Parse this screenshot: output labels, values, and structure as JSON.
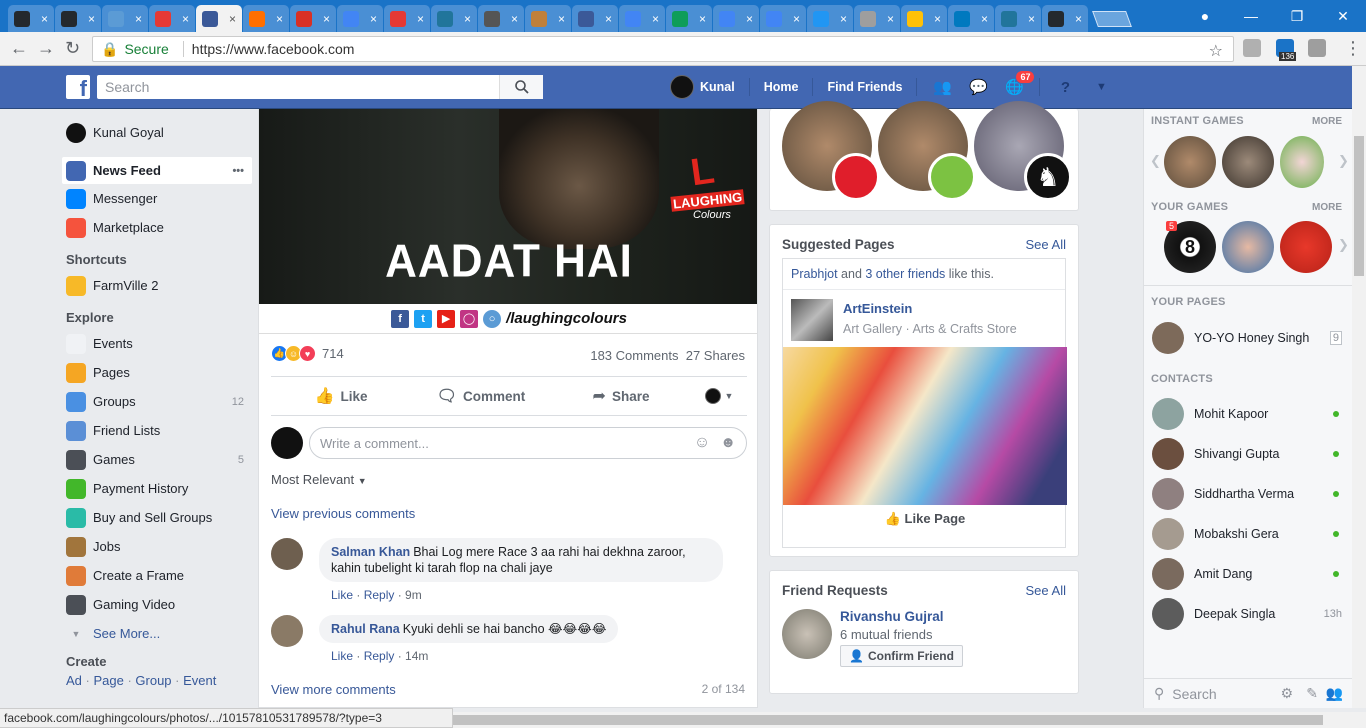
{
  "browser": {
    "tabs": [
      {
        "icon": "github-icon",
        "color": "#24292e",
        "active": false
      },
      {
        "icon": "github-icon",
        "color": "#24292e",
        "active": false
      },
      {
        "icon": "av-icon",
        "color": "#5b9bd5",
        "active": false
      },
      {
        "icon": "mountain-icon",
        "color": "#e53935",
        "active": false
      },
      {
        "icon": "facebook-icon",
        "color": "#3b5998",
        "active": true
      },
      {
        "icon": "chart-icon",
        "color": "#ff6f00",
        "active": false
      },
      {
        "icon": "gmail-icon",
        "color": "#d93025",
        "active": false
      },
      {
        "icon": "google-icon",
        "color": "#4285f4",
        "active": false
      },
      {
        "icon": "stack-icon",
        "color": "#e53935",
        "active": false
      },
      {
        "icon": "wordpress-icon",
        "color": "#21759b",
        "active": false
      },
      {
        "icon": "download-icon",
        "color": "#555555",
        "active": false
      },
      {
        "icon": "cookie-icon",
        "color": "#c0803a",
        "active": false
      },
      {
        "icon": "facebook-icon",
        "color": "#3b5998",
        "active": false
      },
      {
        "icon": "google-icon",
        "color": "#4285f4",
        "active": false
      },
      {
        "icon": "drive-icon",
        "color": "#0f9d58",
        "active": false
      },
      {
        "icon": "google-icon",
        "color": "#4285f4",
        "active": false
      },
      {
        "icon": "google-icon",
        "color": "#4285f4",
        "active": false
      },
      {
        "icon": "ibb-icon",
        "color": "#2196f3",
        "active": false
      },
      {
        "icon": "page-icon",
        "color": "#9e9e9e",
        "active": false
      },
      {
        "icon": "lightning-icon",
        "color": "#ffc107",
        "active": false
      },
      {
        "icon": "trello-icon",
        "color": "#0079bf",
        "active": false
      },
      {
        "icon": "wordpress-icon",
        "color": "#21759b",
        "active": false
      },
      {
        "icon": "github-icon",
        "color": "#24292e",
        "active": false
      }
    ],
    "secure_label": "Secure",
    "url": "https://www.facebook.com",
    "ext_badge": "136",
    "status_url": "facebook.com/laughingcolours/photos/.../10157810531789578/?type=3"
  },
  "fbbar": {
    "search_placeholder": "Search",
    "user": "Kunal",
    "home": "Home",
    "find_friends": "Find Friends",
    "notif_count": "67"
  },
  "leftnav": {
    "profile": "Kunal Goyal",
    "main": [
      {
        "label": "News Feed",
        "icon": "news-feed-icon",
        "color": "#4267b2",
        "active": true
      },
      {
        "label": "Messenger",
        "icon": "messenger-icon",
        "color": "#0084ff"
      },
      {
        "label": "Marketplace",
        "icon": "marketplace-icon",
        "color": "#f5533d"
      }
    ],
    "shortcuts_head": "Shortcuts",
    "shortcuts": [
      {
        "label": "FarmVille 2",
        "icon": "farmville-icon",
        "color": "#f7b928"
      }
    ],
    "explore_head": "Explore",
    "explore": [
      {
        "label": "Events",
        "icon": "calendar-icon",
        "color": "#f0f2f5",
        "count": ""
      },
      {
        "label": "Pages",
        "icon": "flag-icon",
        "color": "#f5a623",
        "count": ""
      },
      {
        "label": "Groups",
        "icon": "groups-icon",
        "color": "#4a90e2",
        "count": "12"
      },
      {
        "label": "Friend Lists",
        "icon": "friend-lists-icon",
        "color": "#5b8fd6",
        "count": ""
      },
      {
        "label": "Games",
        "icon": "games-icon",
        "color": "#4b4f56",
        "count": "5"
      },
      {
        "label": "Payment History",
        "icon": "payment-icon",
        "color": "#42b72a",
        "count": ""
      },
      {
        "label": "Buy and Sell Groups",
        "icon": "tag-icon",
        "color": "#2abba7",
        "count": ""
      },
      {
        "label": "Jobs",
        "icon": "briefcase-icon",
        "color": "#a1753c",
        "count": ""
      },
      {
        "label": "Create a Frame",
        "icon": "frame-icon",
        "color": "#e07b39",
        "count": ""
      },
      {
        "label": "Gaming Video",
        "icon": "gamepad-icon",
        "color": "#4b4f56",
        "count": ""
      }
    ],
    "see_more": "See More...",
    "create_head": "Create",
    "create_links": [
      "Ad",
      "Page",
      "Group",
      "Event"
    ]
  },
  "post": {
    "image_caption": "AADAT HAI",
    "logo_text": "LAUGHING",
    "logo_text2": "Colours",
    "handle": "/laughingcolours",
    "reaction_count": "714",
    "comments": "183 Comments",
    "shares": "27 Shares",
    "like": "Like",
    "comment": "Comment",
    "share": "Share",
    "comment_placeholder": "Write a comment...",
    "sort": "Most Relevant",
    "view_previous": "View previous comments",
    "comment_list": [
      {
        "name": "Salman Khan",
        "text": "Bhai Log mere Race 3 aa rahi hai dekhna zaroor, kahin tubelight ki tarah flop na chali jaye",
        "like": "Like",
        "reply": "Reply",
        "time": "9m"
      },
      {
        "name": "Rahul Rana",
        "text": "Kyuki dehli se hai bancho 😂😂😂😂",
        "like": "Like",
        "reply": "Reply",
        "time": "14m"
      }
    ],
    "view_more": "View more comments",
    "count": "2 of 134"
  },
  "suggested": {
    "title": "Suggested Pages",
    "see_all": "See All",
    "friends_a": "Prabhjot",
    "friends_and": " and ",
    "friends_b": "3 other friends",
    "friends_c": " like this.",
    "page_name": "ArtEinstein",
    "page_cat": "Art Gallery · Arts & Crafts Store",
    "like_page": "Like Page"
  },
  "friend_requests": {
    "title": "Friend Requests",
    "see_all": "See All",
    "name": "Rivanshu Gujral",
    "mutual": "6 mutual friends",
    "confirm": "Confirm Friend"
  },
  "chat": {
    "instant_games": "INSTANT GAMES",
    "your_games": "YOUR GAMES",
    "more": "MORE",
    "game_badge": "5",
    "your_pages": "YOUR PAGES",
    "page_name": "YO-YO Honey Singh",
    "page_count": "9",
    "contacts_head": "CONTACTS",
    "contacts": [
      {
        "name": "Mohit Kapoor",
        "online": true,
        "time": ""
      },
      {
        "name": "Shivangi Gupta",
        "online": true,
        "time": ""
      },
      {
        "name": "Siddhartha Verma",
        "online": true,
        "time": ""
      },
      {
        "name": "Mobakshi Gera",
        "online": true,
        "time": ""
      },
      {
        "name": "Amit Dang",
        "online": true,
        "time": ""
      },
      {
        "name": "Deepak Singla",
        "online": false,
        "time": "13h"
      }
    ],
    "search": "Search"
  }
}
